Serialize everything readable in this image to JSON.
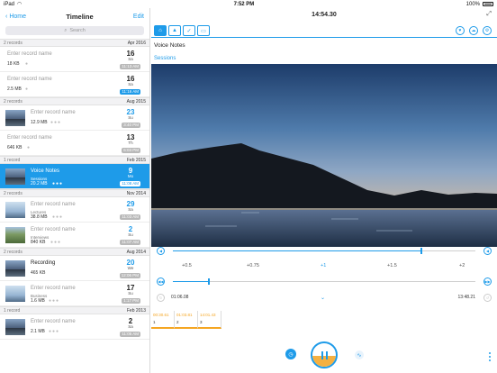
{
  "status": {
    "device": "iPad",
    "time": "7:52 PM",
    "battery": "100%"
  },
  "left": {
    "back_label": "Home",
    "title": "Timeline",
    "edit_label": "Edit",
    "search_placeholder": "Search",
    "groups": [
      {
        "count": "2 records",
        "date": "Apr 2016"
      },
      {
        "count": "2 records",
        "date": "Aug 2015"
      },
      {
        "count": "1 record",
        "date": "Feb 2015"
      },
      {
        "count": "2 records",
        "date": "Nov 2014"
      },
      {
        "count": "2 records",
        "date": "Aug 2014"
      },
      {
        "count": "1 record",
        "date": "Feb 2013"
      }
    ],
    "records": [
      {
        "name": "Enter record name",
        "size": "18 KB",
        "day": "16",
        "weekday": "Sa",
        "time": "11:13 AM"
      },
      {
        "name": "Enter record name",
        "size": "2.5 MB",
        "day": "16",
        "weekday": "Sa",
        "time": "11:16 AM"
      },
      {
        "name": "Enter record name",
        "size": "12.9 MB",
        "day": "23",
        "weekday": "Su",
        "time": "3:40 PM"
      },
      {
        "name": "Enter record name",
        "size": "646 KB",
        "day": "13",
        "weekday": "Th",
        "time": "6:03 PM"
      },
      {
        "name": "Voice Notes",
        "sub": "Sessions",
        "size": "20.2 MB",
        "day": "9",
        "weekday": "Mo",
        "time": "11:08 AM"
      },
      {
        "name": "Enter record name",
        "sub": "Lectures",
        "size": "38.8 MB",
        "day": "29",
        "weekday": "Sa",
        "time": "11:03 AM"
      },
      {
        "name": "Enter record name",
        "sub": "Interviews",
        "size": "840 KB",
        "day": "2",
        "weekday": "Su",
        "time": "11:07 AM"
      },
      {
        "name": "Recording",
        "size": "465 KB",
        "day": "20",
        "weekday": "We",
        "time": "12:06 PM"
      },
      {
        "name": "Enter record name",
        "sub": "Business",
        "size": "1.6 MB",
        "day": "17",
        "weekday": "Su",
        "time": "1:17 PM"
      },
      {
        "name": "Enter record name",
        "size": "2.1 MB",
        "day": "2",
        "weekday": "Sa",
        "time": "11:05 AM"
      }
    ]
  },
  "right": {
    "clock": "14:54.30",
    "note_title": "Voice Notes",
    "note_category": "Sessions",
    "speeds": [
      "+0.5",
      "+0.75",
      "+1",
      "+1.5",
      "+2"
    ],
    "position_start": "01:06.08",
    "position_end": "13:48.21",
    "position_fraction": 0.12,
    "volume_fraction": 0.82,
    "level_fraction": 0.45,
    "marks": [
      {
        "time": "00:30.61",
        "num": "1"
      },
      {
        "time": "01:03.81",
        "num": "2"
      },
      {
        "time": "14:01.43",
        "num": "3"
      }
    ]
  }
}
